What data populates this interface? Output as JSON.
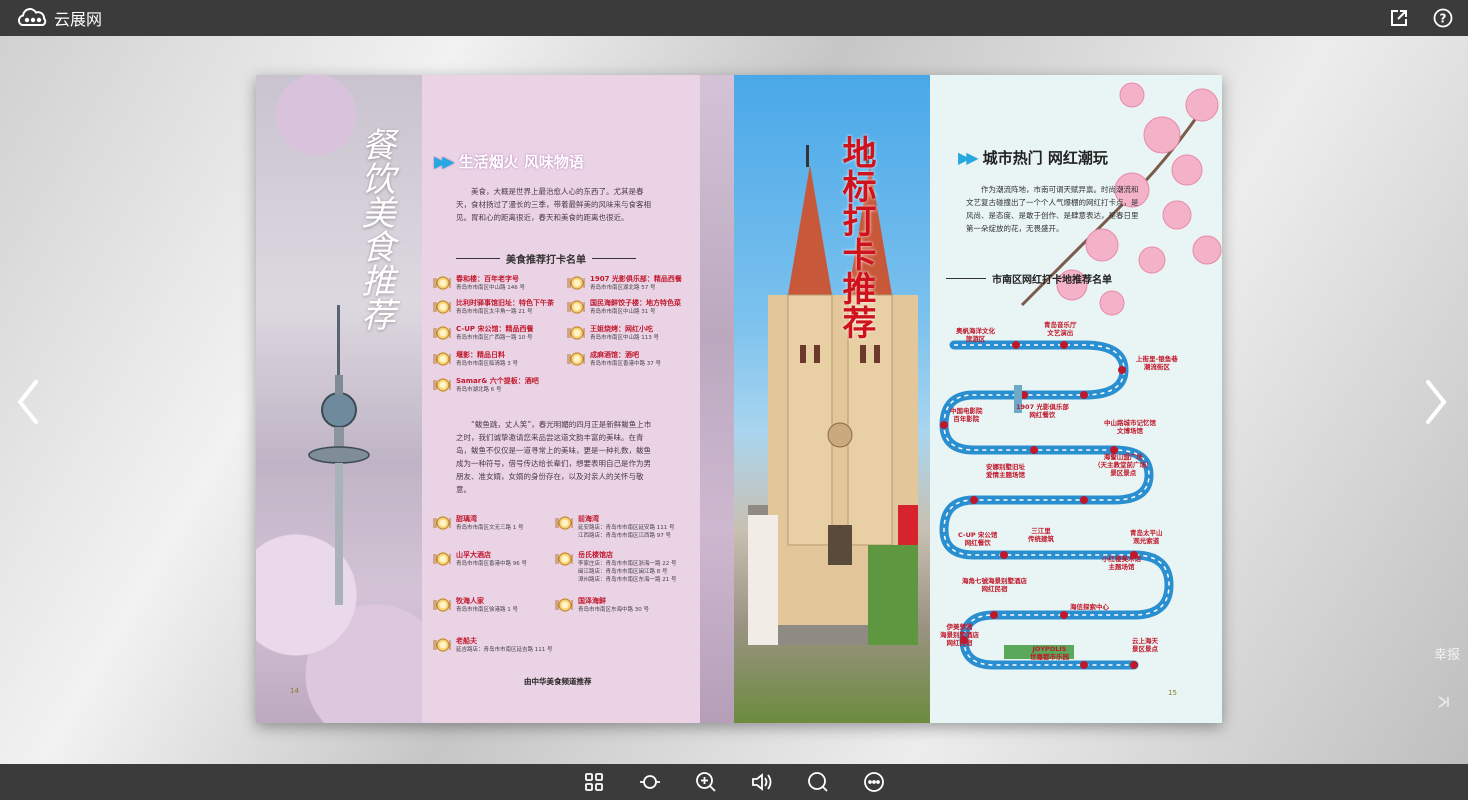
{
  "app": {
    "brand_name": "云展网",
    "top_icons": [
      "share-icon",
      "help-icon"
    ]
  },
  "nav": {
    "prev_icon": "chevron-left-icon",
    "next_icon": "chevron-right-icon",
    "first_icon": "first-page-icon",
    "last_icon": "last-page-icon",
    "watermark": "幸报"
  },
  "toolbar": {
    "tools": [
      "thumbnails-icon",
      "autoplay-icon",
      "zoom-in-icon",
      "sound-icon",
      "search-icon",
      "more-icon"
    ]
  },
  "left_page": {
    "vertical_title": "餐饮美食推荐",
    "section_title": "生活烟火 风味物语",
    "intro": "美食，大概是世界上最治愈人心的东西了。尤其是春天，食材扬过了漫长的三季，带着最鲜美的风味来与食客相见。胃和心的距离很近，春天和美食的距离也很近。",
    "list_title": "美食推荐打卡名单",
    "restaurants_top": [
      {
        "name": "春和楼：百年老字号",
        "addr": "青岛市市南区中山路 146 号"
      },
      {
        "name": "1907 光影俱乐部：精品西餐",
        "addr": "青岛市市南区湖北路 57 号"
      },
      {
        "name": "比利时驿事馆旧址：特色下午茶",
        "addr": "青岛市市南区太平角一路 21 号"
      },
      {
        "name": "国民海鲜饺子楼：地方特色菜",
        "addr": "青岛市市南区中山路 31 号"
      },
      {
        "name": "C-UP 宋公馆：精品西餐",
        "addr": "青岛市市南区广西路一路 10 号"
      },
      {
        "name": "王姐烧烤：网红小吃",
        "addr": "青岛市市南区中山路 113 号"
      },
      {
        "name": "堰影：精品日料",
        "addr": "青岛市市南区临清路 3 号"
      },
      {
        "name": "成麻酒馆：酒吧",
        "addr": "青岛市市南区香港中路 37 号"
      },
      {
        "name": "Samar& 六个提板：酒吧",
        "addr": "青岛市湖北路 6 号"
      }
    ],
    "intro2": "“鲅鱼跳，丈人笑”，春光明媚的四月正是新鲜鲅鱼上市之时，我们诚挚邀请您来品尝这道文韵丰富的美味。在青岛，鲅鱼不仅仅是一道寻常上的美味，更是一种礼数，鲅鱼成为一种符号，借号传达给长辈们，想要表明自己是作为男朋友、准女婿，女婿的身份存在，以及对亲人的关怀与敬意。",
    "restaurants_bottom": [
      {
        "name": "甜璃湾",
        "addr": "青岛市市南区文无三路 1 号"
      },
      {
        "name": "前海湾",
        "addr": "延安路店：青岛市市南区延安路 111 号\n江西路店：青岛市市南区江西路 97 号"
      },
      {
        "name": "山孚大酒店",
        "addr": "青岛市市南区香港中路 96 号"
      },
      {
        "name": "岳氏楼馆店",
        "addr": "李家庄店：青岛市市南区浙海一路 22 号\n闽江路店：青岛市市南区闽江路 8 号\n漳州路店：青岛市市南区东海一路 21 号"
      },
      {
        "name": "牧海人家",
        "addr": "青岛市市南区徐港路 1 号"
      },
      {
        "name": "国泽海鲜",
        "addr": "青岛市市南区东海中路 30 号"
      },
      {
        "name": "老船夫",
        "addr": "延吉路店：青岛市市南区延吉路 111 号"
      }
    ],
    "credit": "由中华美食频道推荐",
    "page_number": "14"
  },
  "right_page": {
    "vertical_title": "地标打卡推荐",
    "section_title": "城市热门 网红潮玩",
    "intro": "作为潮流阵地，市南可谓天赋异禀。时尚潮流和文艺复古碰撞出了一个个人气爆棚的网红打卡点，是风尚、是态度、是敢于创作、是肆意表达，是春日里第一朵绽放的花，无畏盛开。",
    "list_title": "市南区网红打卡地推荐名单",
    "spots": [
      "奥帆海洋文化\n旅游区",
      "青岛音乐厅\n文艺演出",
      "上街里-银鱼巷\n潮流街区",
      "中国电影院\n百年影院",
      "1907 光影俱乐部\n网红餐饮",
      "中山路城市记忆馆\n文博场馆",
      "海誓山盟广场\n（天主教堂前广场）\n景区景点",
      "安娜别墅旧址\n爱情主题场馆",
      "C-UP 宋公馆\n网红餐饮",
      "三江里\n传统建筑",
      "青岛太平山\n观光索道",
      "小红楼美术馆\n主题场馆",
      "海角七號海景别墅酒店\n网红民宿",
      "海信探索中心",
      "伊美萝茜\n海景别墅酒店\n网红民宿",
      "JOYPOLIS\n世嘉都市乐园",
      "云上海天\n景区景点"
    ],
    "page_number": "15"
  },
  "colors": {
    "toolbar_bg": "#3b3b3b",
    "accent_red": "#c0182b",
    "accent_blue": "#27a7e0",
    "left_panel": "#ebd3e6",
    "right_panel": "#e9f5f4"
  }
}
